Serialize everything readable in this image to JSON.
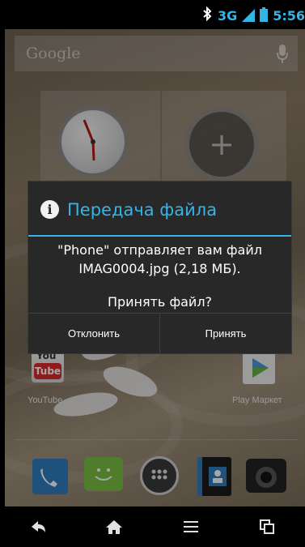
{
  "status_bar": {
    "network": "3G",
    "time": "5:56",
    "icons": [
      "bluetooth-icon",
      "signal-icon",
      "battery-icon"
    ]
  },
  "home": {
    "search_bar": {
      "brand": "Google",
      "icon": "mic-icon"
    },
    "apps": [
      {
        "label": "YouTube",
        "icon_text_top": "You",
        "icon_text_bottom": "Tube"
      },
      {
        "label": "Play Маркет",
        "icon": "play-market-icon"
      }
    ],
    "dock": [
      "phone-icon",
      "messaging-icon",
      "app-drawer-icon",
      "contacts-icon",
      "camera-icon"
    ]
  },
  "dialog": {
    "title": "Передача файла",
    "message_line1": "\"Phone\" отправляет вам файл",
    "message_line2": "IMAG0004.jpg (2,18 МБ).",
    "question": "Принять файл?",
    "decline_label": "Отклонить",
    "accept_label": "Принять"
  },
  "navigation": {
    "buttons": [
      "back-icon",
      "home-icon",
      "menu-icon",
      "recent-apps-icon"
    ]
  },
  "colors": {
    "accent": "#33b5e5",
    "dialog_bg": "#282828",
    "status_bar_bg": "#000000"
  }
}
